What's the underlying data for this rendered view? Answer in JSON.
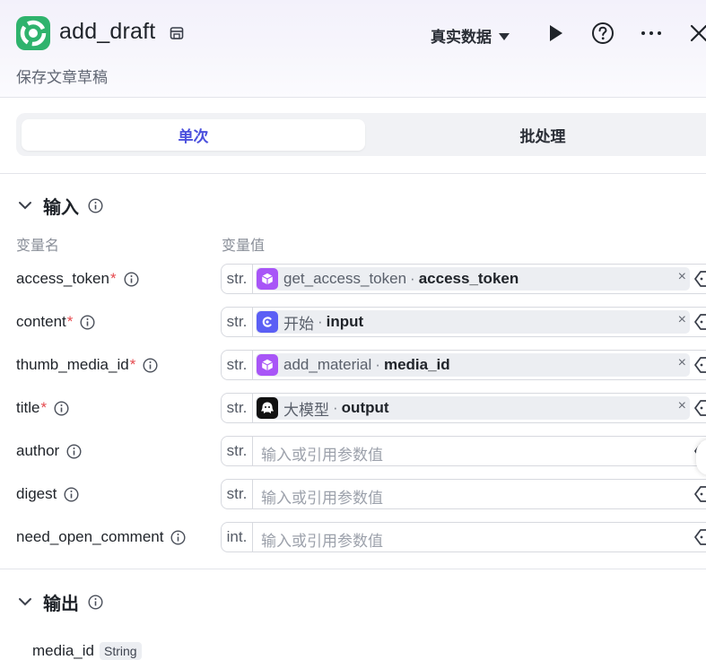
{
  "header": {
    "title": "add_draft",
    "subtitle": "保存文章草稿",
    "data_mode": "真实数据",
    "icons": [
      "play-icon",
      "help-icon",
      "more-icon",
      "close-icon"
    ]
  },
  "tabs": [
    {
      "label": "单次",
      "active": true
    },
    {
      "label": "批处理",
      "active": false
    }
  ],
  "input_section": {
    "title": "输入",
    "col_name": "变量名",
    "col_value": "变量值",
    "rows": [
      {
        "name": "access_token",
        "required": "*",
        "type": "str.",
        "node": "get_access_token",
        "var": "access_token",
        "clear": "×"
      },
      {
        "name": "content",
        "required": "*",
        "type": "str.",
        "node": "开始",
        "var": "input",
        "clear": "×"
      },
      {
        "name": "thumb_media_id",
        "required": "*",
        "type": "str.",
        "node": "add_material",
        "var": "media_id",
        "clear": "×"
      },
      {
        "name": "title",
        "required": "*",
        "type": "str.",
        "node": "大模型",
        "var": "output",
        "clear": "×"
      },
      {
        "name": "author",
        "type": "str.",
        "placeholder": "输入或引用参数值"
      },
      {
        "name": "digest",
        "type": "str.",
        "placeholder": "输入或引用参数值"
      },
      {
        "name": "need_open_comment",
        "type": "int.",
        "placeholder": "输入或引用参数值"
      }
    ]
  },
  "output_section": {
    "title": "输出",
    "items": [
      {
        "name": "media_id",
        "type": "String"
      }
    ]
  },
  "colors": {
    "accent": "#4b50dd",
    "plugin_purple": "#a855f7",
    "start_blue": "#5b5ff5",
    "required_red": "#e5484d",
    "logo_green": "#2fb36d"
  }
}
